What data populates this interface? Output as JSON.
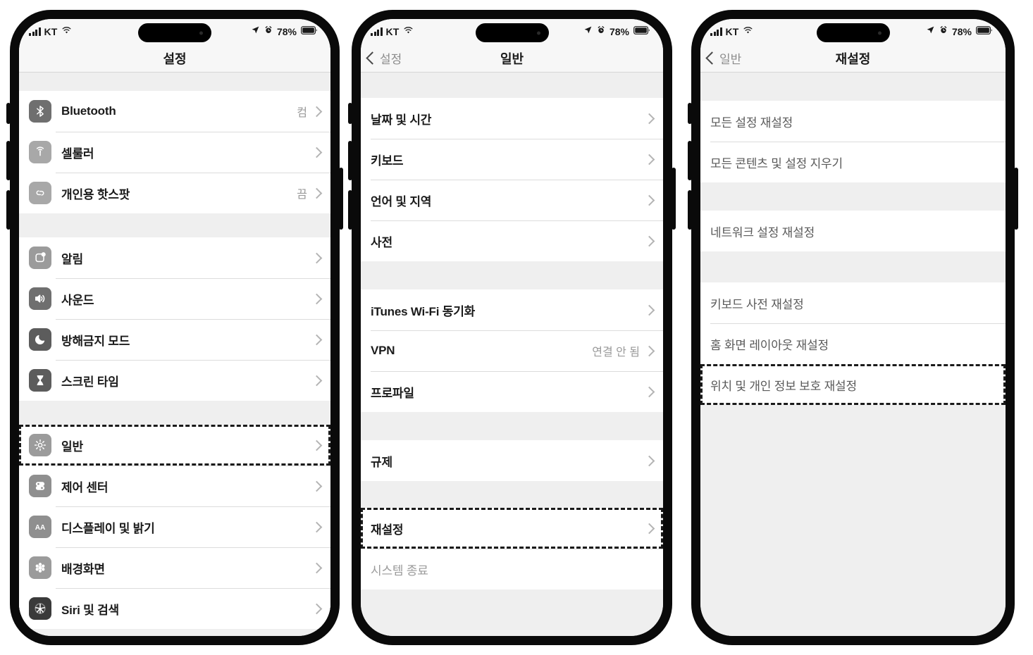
{
  "status_bar": {
    "carrier": "KT",
    "battery_percent": "78%",
    "icons": [
      "signal-bars-icon",
      "wifi-icon",
      "location-arrow-icon",
      "alarm-clock-icon",
      "battery-icon"
    ]
  },
  "phones": [
    {
      "name": "settings-root",
      "nav": {
        "back_label": "",
        "title": "설정",
        "has_back": false
      },
      "sections": [
        {
          "rows": [
            {
              "label": "Bluetooth",
              "value": "컴",
              "icon": "bluetooth-icon",
              "chevron": true,
              "highlighted": false
            },
            {
              "label": "셀룰러",
              "value": "",
              "icon": "cellular-icon",
              "chevron": true,
              "highlighted": false
            },
            {
              "label": "개인용 핫스팟",
              "value": "끔",
              "icon": "personal-hotspot-icon",
              "chevron": true,
              "highlighted": false
            }
          ]
        },
        {
          "rows": [
            {
              "label": "알림",
              "value": "",
              "icon": "notifications-icon",
              "chevron": true,
              "highlighted": false
            },
            {
              "label": "사운드",
              "value": "",
              "icon": "sounds-icon",
              "chevron": true,
              "highlighted": false
            },
            {
              "label": "방해금지 모드",
              "value": "",
              "icon": "do-not-disturb-icon",
              "chevron": true,
              "highlighted": false
            },
            {
              "label": "스크린 타임",
              "value": "",
              "icon": "screen-time-icon",
              "chevron": true,
              "highlighted": false
            }
          ]
        },
        {
          "rows": [
            {
              "label": "일반",
              "value": "",
              "icon": "gear-icon",
              "chevron": true,
              "highlighted": true
            },
            {
              "label": "제어 센터",
              "value": "",
              "icon": "control-center-icon",
              "chevron": true,
              "highlighted": false
            },
            {
              "label": "디스플레이 및 밝기",
              "value": "",
              "icon": "display-brightness-icon",
              "chevron": true,
              "highlighted": false
            },
            {
              "label": "배경화면",
              "value": "",
              "icon": "wallpaper-icon",
              "chevron": true,
              "highlighted": false
            },
            {
              "label": "Siri 및 검색",
              "value": "",
              "icon": "siri-icon",
              "chevron": true,
              "highlighted": false
            }
          ]
        }
      ]
    },
    {
      "name": "settings-general",
      "nav": {
        "back_label": "설정",
        "title": "일반",
        "has_back": true
      },
      "sections": [
        {
          "rows": [
            {
              "label": "날짜 및 시간",
              "value": "",
              "icon": "",
              "chevron": true,
              "highlighted": false
            },
            {
              "label": "키보드",
              "value": "",
              "icon": "",
              "chevron": true,
              "highlighted": false
            },
            {
              "label": "언어 및 지역",
              "value": "",
              "icon": "",
              "chevron": true,
              "highlighted": false
            },
            {
              "label": "사전",
              "value": "",
              "icon": "",
              "chevron": true,
              "highlighted": false
            }
          ]
        },
        {
          "rows": [
            {
              "label": "iTunes Wi-Fi 동기화",
              "value": "",
              "icon": "",
              "chevron": true,
              "highlighted": false
            },
            {
              "label": "VPN",
              "value": "연결 안 됨",
              "icon": "",
              "chevron": true,
              "highlighted": false
            },
            {
              "label": "프로파일",
              "value": "",
              "icon": "",
              "chevron": true,
              "highlighted": false
            }
          ]
        },
        {
          "rows": [
            {
              "label": "규제",
              "value": "",
              "icon": "",
              "chevron": true,
              "highlighted": false
            }
          ]
        },
        {
          "rows": [
            {
              "label": "재설정",
              "value": "",
              "icon": "",
              "chevron": true,
              "highlighted": true
            },
            {
              "label": "시스템 종료",
              "value": "",
              "icon": "",
              "chevron": false,
              "highlighted": false,
              "soft": true
            }
          ]
        }
      ]
    },
    {
      "name": "settings-reset",
      "nav": {
        "back_label": "일반",
        "title": "재설정",
        "has_back": true
      },
      "sections": [
        {
          "rows": [
            {
              "label": "모든 설정 재설정",
              "value": "",
              "icon": "",
              "chevron": false,
              "highlighted": false,
              "dim": true
            },
            {
              "label": "모든 콘텐츠 및 설정 지우기",
              "value": "",
              "icon": "",
              "chevron": false,
              "highlighted": false,
              "dim": true
            }
          ]
        },
        {
          "rows": [
            {
              "label": "네트워크 설정 재설정",
              "value": "",
              "icon": "",
              "chevron": false,
              "highlighted": false,
              "dim": true
            }
          ]
        },
        {
          "rows": [
            {
              "label": "키보드 사전 재설정",
              "value": "",
              "icon": "",
              "chevron": false,
              "highlighted": false,
              "dim": true
            },
            {
              "label": "홈 화면 레이아웃 재설정",
              "value": "",
              "icon": "",
              "chevron": false,
              "highlighted": false,
              "dim": true
            },
            {
              "label": "위치 및 개인 정보 보호 재설정",
              "value": "",
              "icon": "",
              "chevron": false,
              "highlighted": true,
              "dim": true
            }
          ]
        }
      ]
    }
  ],
  "colors": {
    "frame": "#0a0a0a",
    "screen_bg": "#efefef",
    "row_bg": "#ffffff",
    "separator": "#dcdcdc",
    "label": "#1b1b1b",
    "value": "#9a9a9a",
    "highlight_outline": "#1a1a1a"
  }
}
